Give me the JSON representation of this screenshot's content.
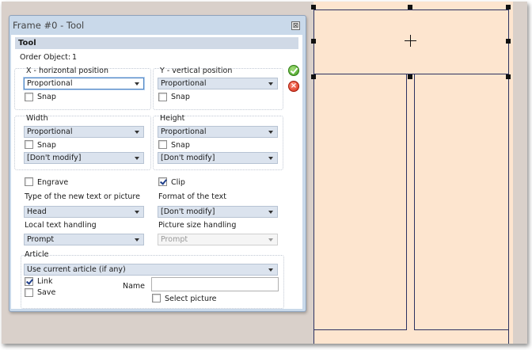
{
  "window": {
    "title": "Frame #0 - Tool",
    "close_glyph": "⊠"
  },
  "section": {
    "title": "Tool"
  },
  "order_object": {
    "label": "Order Object:",
    "value": "1"
  },
  "x_position": {
    "label": "X - horizontal position",
    "value": "Proportional",
    "snap_label": "Snap",
    "snap_checked": false
  },
  "y_position": {
    "label": "Y - vertical position",
    "value": "Proportional",
    "snap_label": "Snap",
    "snap_checked": false
  },
  "width": {
    "label": "Width",
    "value": "Proportional",
    "snap_label": "Snap",
    "snap_checked": false,
    "modify": "[Don't modify]"
  },
  "height": {
    "label": "Height",
    "value": "Proportional",
    "snap_label": "Snap",
    "snap_checked": false,
    "modify": "[Don't modify]"
  },
  "engrave": {
    "label": "Engrave",
    "checked": false
  },
  "clip": {
    "label": "Clip",
    "checked": true
  },
  "new_text_type": {
    "label": "Type of the new text or picture",
    "value": "Head"
  },
  "text_format": {
    "label": "Format of the text",
    "value": "[Don't modify]"
  },
  "local_text": {
    "label": "Local text handling",
    "value": "Prompt"
  },
  "picture_size": {
    "label": "Picture size handling",
    "value": "Prompt",
    "disabled": true
  },
  "article": {
    "label": "Article",
    "value": "Use current article (if any)",
    "link_label": "Link",
    "link_checked": true,
    "save_label": "Save",
    "save_checked": false,
    "name_label": "Name",
    "name_value": "",
    "select_picture_label": "Select picture",
    "select_picture_checked": false
  },
  "actions": {
    "ok_icon": "green-check-icon",
    "cancel_icon": "red-x-icon"
  },
  "colors": {
    "canvas": "#fde5cf",
    "panel": "#c9d9ea",
    "desk": "#d9d0ca",
    "frame_lines": "#2c3160"
  }
}
